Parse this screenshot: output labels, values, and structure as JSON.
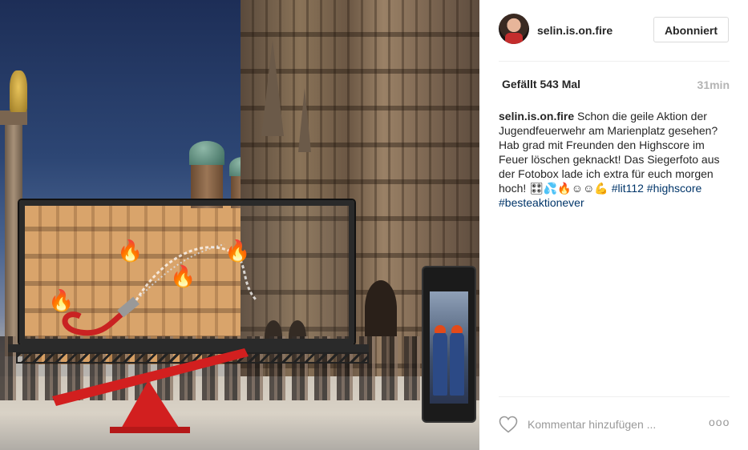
{
  "post": {
    "username": "selin.is.on.fire",
    "follow_label": "Abonniert",
    "likes": "Gefällt 543 Mal",
    "time": "31min",
    "caption": {
      "user": "selin.is.on.fire",
      "text": "Schon die geile Aktion der Jugendfeuerwehr am Marienplatz gesehen? Hab grad mit Freunden den Highscore im Feuer löschen geknackt! Das Siegerfoto aus der Fotobox lade ich extra für euch morgen hoch! 🎛💦🔥☺☺💪",
      "tags": [
        "#lit112",
        "#highscore",
        "#besteaktionever"
      ]
    }
  },
  "comment": {
    "placeholder": "Kommentar hinzufügen ...",
    "more": "ooo"
  },
  "icons": {
    "like": "heart-icon",
    "more": "more-options-icon",
    "flame": "fire-icon"
  },
  "colors": {
    "text": "#262626",
    "hashtag": "#003569",
    "muted": "#999999",
    "divider": "#efefef"
  }
}
